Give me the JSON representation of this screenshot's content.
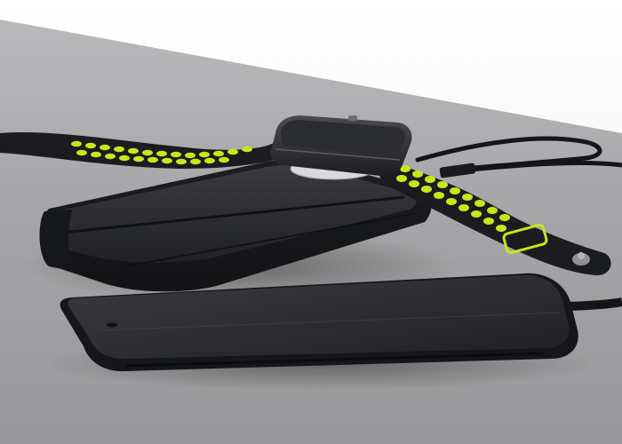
{
  "scene": {
    "subjects": [
      "smartwatch",
      "sport-band-with-perforations",
      "wireless-charging-power-bank",
      "smartphone",
      "charging-cable"
    ]
  },
  "colors": {
    "background_wall": "#f6f6f6",
    "table_surface": "#a7a7a9",
    "device_body": "#1e1f22",
    "band": "#1b1c1f",
    "band_holes": "#c8e619",
    "phone_screen": "#2a2b2e",
    "cable": "#111214"
  }
}
